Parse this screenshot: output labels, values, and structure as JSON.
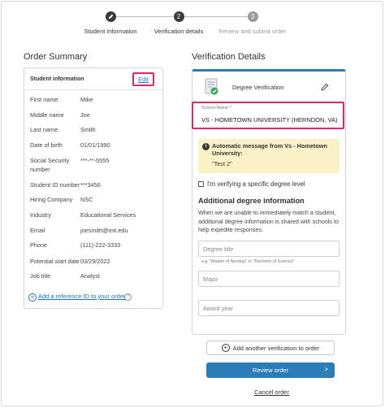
{
  "stepper": {
    "steps": [
      {
        "label": "Student information",
        "number": ""
      },
      {
        "label": "Verification details",
        "number": "2"
      },
      {
        "label": "Review and submit order",
        "number": "3"
      }
    ]
  },
  "summary": {
    "title": "Order Summary",
    "card_title": "Student information",
    "edit_label": "Edit",
    "rows": [
      {
        "key": "First name",
        "value": "Mike"
      },
      {
        "key": "Middle name",
        "value": "Joe"
      },
      {
        "key": "Last name",
        "value": "Smith"
      },
      {
        "key": "Date of birth",
        "value": " 01/01/1990"
      },
      {
        "key": "Social Security number",
        "value": "***-**-5555"
      },
      {
        "key": "Student ID number",
        "value": "***3456"
      },
      {
        "key": "Hiring Company",
        "value": "NSC"
      },
      {
        "key": "Industry",
        "value": "Educational Services"
      },
      {
        "key": "Email",
        "value": "joesmith@mit.edu"
      },
      {
        "key": "Phone",
        "value": "(111)-222-3333"
      },
      {
        "key": "Potential start date",
        "value": "03/29/2022"
      },
      {
        "key": "Job title",
        "value": "Analyst"
      }
    ],
    "ref_link": "Add a reference ID to your order"
  },
  "verification": {
    "title": "Verification Details",
    "degree_title": "Degree Verification",
    "school_label": "School Name *",
    "school_value": "VS - HOMETOWN UNIVERSITY (HERNDON, VA)",
    "auto_title": "Automatic message from Vs - Hometown University:",
    "auto_body": "\"Test 2\"",
    "checkbox_label": "I'm verifying a specific degree level",
    "additional_title": "Additional degree information",
    "additional_desc": "When we are unable to immediately match a student, additional degree information is shared with schools to help expedite responses.",
    "degree_title_placeholder": "Degree title",
    "degree_hint": "e.g. \"Master of Nursing\" or \"Bachelor of Science\"",
    "major_placeholder": "Major",
    "award_year_placeholder": "Award year"
  },
  "actions": {
    "add_another": "Add another verification to order",
    "review": "Review order",
    "review_arrow": ">",
    "cancel": "Cancel order"
  },
  "colors": {
    "accent": "#2b7cb7",
    "highlight": "#e0266b",
    "notice_bg": "#fbf1c6"
  }
}
